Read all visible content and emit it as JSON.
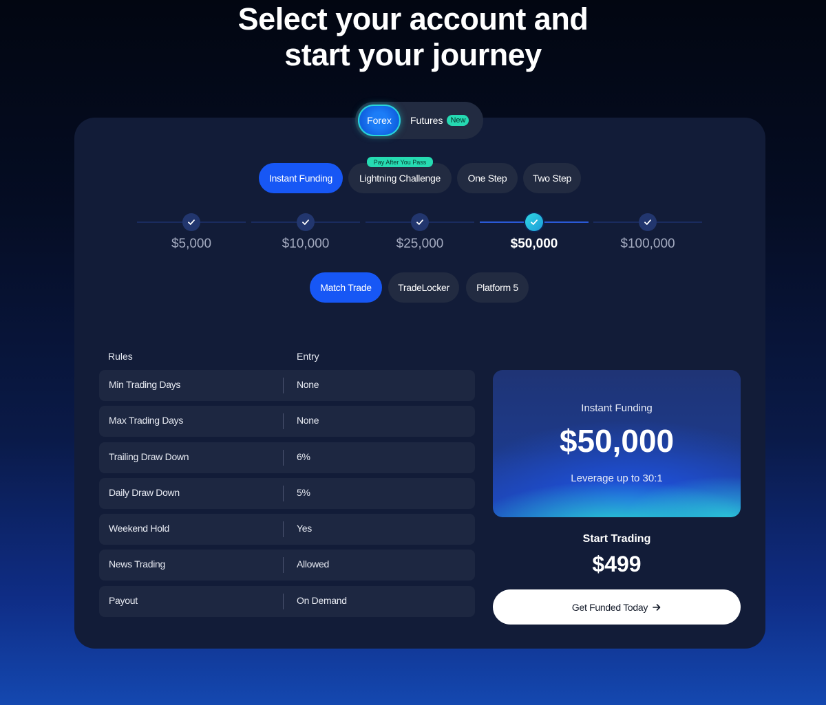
{
  "headline": {
    "line1": "Select your account and",
    "line2": "start your journey"
  },
  "market_toggle": {
    "forex": "Forex",
    "futures": "Futures",
    "futures_badge": "New",
    "selected": "Forex"
  },
  "program_tabs": [
    {
      "label": "Instant Funding",
      "active": true
    },
    {
      "label": "Lightning Challenge",
      "badge": "Pay After You Pass",
      "active": false
    },
    {
      "label": "One Step",
      "active": false
    },
    {
      "label": "Two Step",
      "active": false
    }
  ],
  "account_sizes": [
    {
      "label": "$5,000",
      "active": false
    },
    {
      "label": "$10,000",
      "active": false
    },
    {
      "label": "$25,000",
      "active": false
    },
    {
      "label": "$50,000",
      "active": true
    },
    {
      "label": "$100,000",
      "active": false
    }
  ],
  "platform_tabs": [
    {
      "label": "Match Trade",
      "active": true
    },
    {
      "label": "TradeLocker",
      "active": false
    },
    {
      "label": "Platform 5",
      "active": false
    }
  ],
  "rules_table": {
    "headers": [
      "Rules",
      "Entry"
    ],
    "rows": [
      {
        "rule": "Min Trading Days",
        "value": "None"
      },
      {
        "rule": "Max Trading Days",
        "value": "None"
      },
      {
        "rule": "Trailing Draw Down",
        "value": "6%"
      },
      {
        "rule": "Daily Draw Down",
        "value": "5%"
      },
      {
        "rule": "Weekend Hold",
        "value": "Yes"
      },
      {
        "rule": "News Trading",
        "value": "Allowed"
      },
      {
        "rule": "Payout",
        "value": "On Demand"
      }
    ]
  },
  "summary_card": {
    "program": "Instant Funding",
    "amount": "$50,000",
    "leverage": "Leverage up to 30:1"
  },
  "pricing": {
    "label": "Start Trading",
    "price": "$499"
  },
  "cta": {
    "label": "Get Funded Today",
    "icon": "arrow-right-icon"
  },
  "colors": {
    "accent_blue": "#1757f5",
    "accent_teal": "#26dbb2",
    "card_bg": "#121c38",
    "row_bg": "#1d2741"
  }
}
